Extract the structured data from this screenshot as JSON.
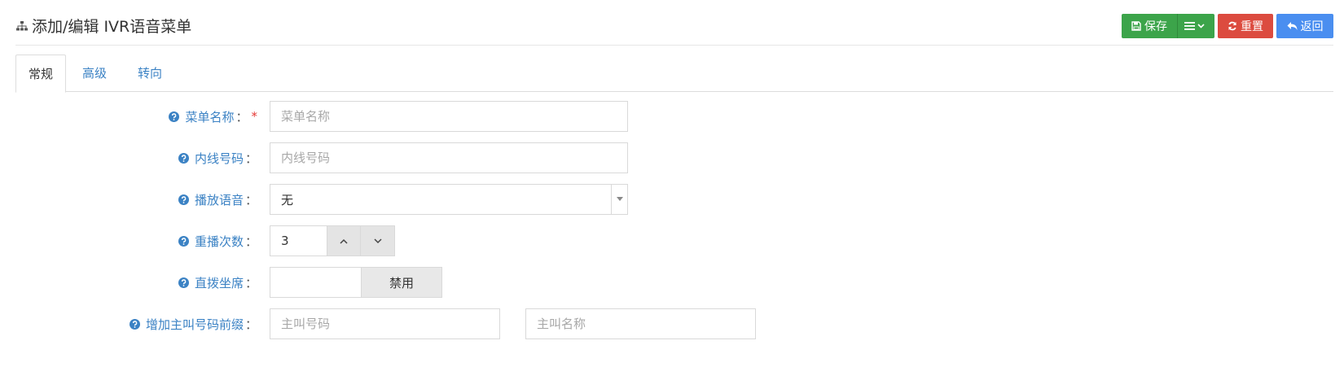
{
  "header": {
    "title": "添加/编辑 IVR语音菜单",
    "title_icon": "sitemap-icon"
  },
  "toolbar": {
    "save_label": "保存",
    "save_icon": "floppy-disk-icon",
    "menu_icon": "list-dropdown-icon",
    "reset_label": "重置",
    "reset_icon": "refresh-icon",
    "back_label": "返回",
    "back_icon": "reply-icon"
  },
  "tabs": [
    {
      "label": "常规",
      "active": true
    },
    {
      "label": "高级",
      "active": false
    },
    {
      "label": "转向",
      "active": false
    }
  ],
  "form": {
    "menu_name": {
      "label": "菜单名称",
      "colon": "：",
      "required_mark": "*",
      "placeholder": "菜单名称",
      "value": ""
    },
    "extension": {
      "label": "内线号码",
      "colon": "：",
      "placeholder": "内线号码",
      "value": ""
    },
    "play_voice": {
      "label": "播放语音",
      "colon": "：",
      "selected": "无"
    },
    "replay_count": {
      "label": "重播次数",
      "colon": "：",
      "value": "3"
    },
    "direct_dial": {
      "label": "直拨坐席",
      "colon": "：",
      "toggle_label": "禁用"
    },
    "caller_prefix": {
      "label": "增加主叫号码前缀",
      "colon": "：",
      "number_placeholder": "主叫号码",
      "name_placeholder": "主叫名称"
    }
  },
  "colors": {
    "save": "#3ca44a",
    "reset": "#dc4b3f",
    "back": "#4a8ef0",
    "label": "#3b82c4",
    "required": "#e53935"
  }
}
